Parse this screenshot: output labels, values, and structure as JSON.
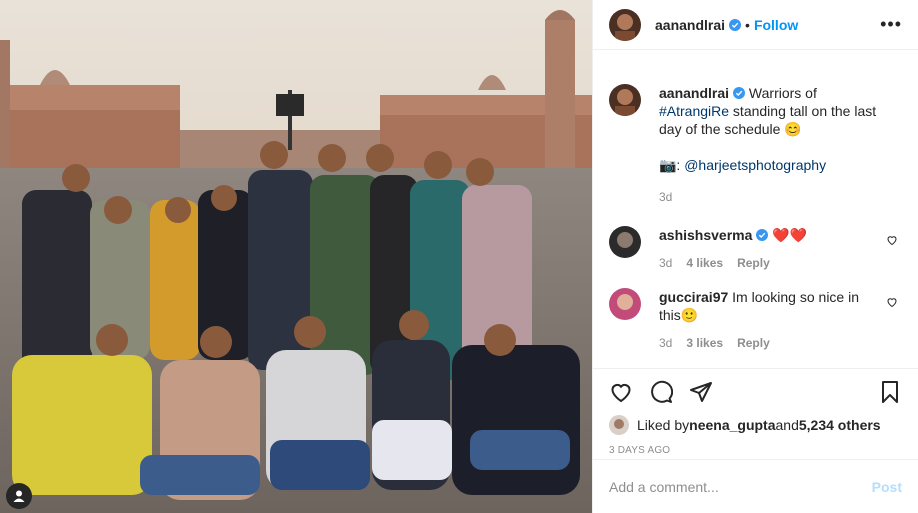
{
  "post": {
    "author": "aanandlrai",
    "follow_label": "Follow",
    "dot": "•",
    "more_label": "•••"
  },
  "caption": {
    "author": "aanandlrai",
    "text_before": " Warriors of ",
    "hashtag": "#AtrangiRe",
    "text_after": " standing tall on the last day of the schedule 😊",
    "camera": "📷: ",
    "mention": "@harjeetsphotography",
    "age": "3d"
  },
  "comments": [
    {
      "author": "ashishsverma",
      "text": "❤️❤️",
      "age": "3d",
      "likes": "4 likes",
      "reply": "Reply"
    },
    {
      "author": "guccirai97",
      "text": "Im looking so nice in this🙂",
      "age": "3d",
      "likes": "3 likes",
      "reply": "Reply"
    }
  ],
  "likes": {
    "prefix": "Liked by ",
    "user": "neena_gupta",
    "middle": " and ",
    "count": "5,234 others"
  },
  "timestamp": "3 DAYS AGO",
  "comment_box": {
    "placeholder": "Add a comment...",
    "post_label": "Post"
  },
  "colors": {
    "link": "#0095f6",
    "verified": "#3897f0",
    "hashtag": "#00376b",
    "heart": "#ed4956"
  }
}
